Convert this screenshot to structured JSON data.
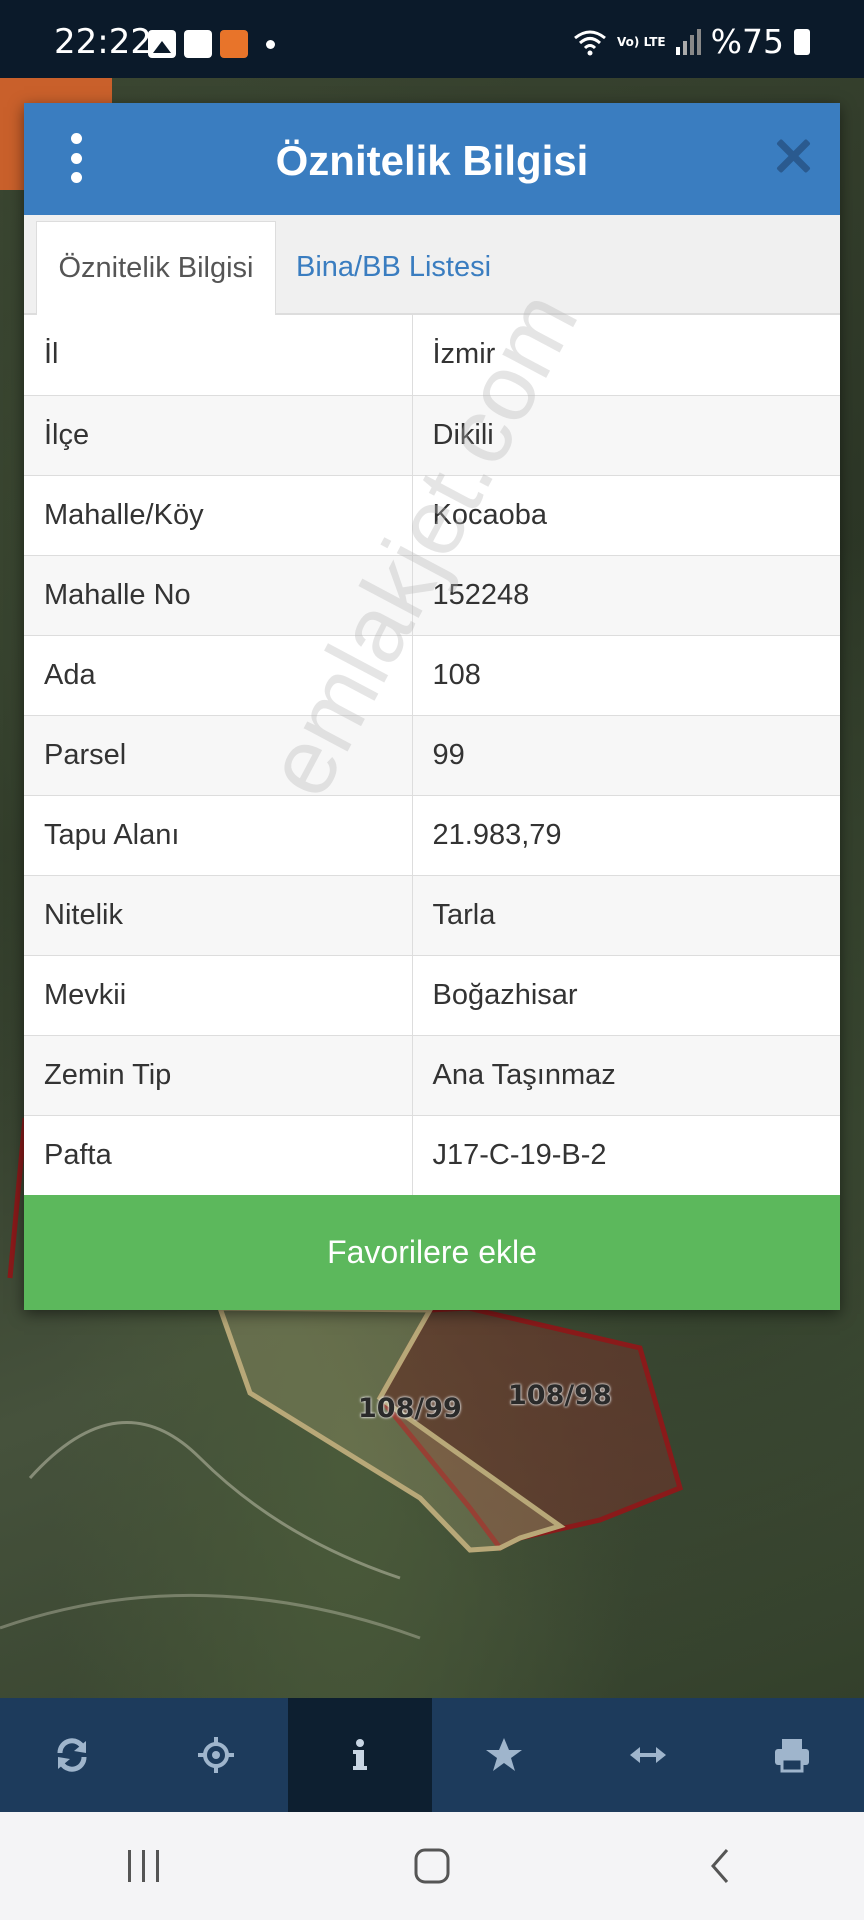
{
  "status_bar": {
    "time": "22:22",
    "network": "Vo) LTE",
    "battery": "%75"
  },
  "map": {
    "parcel_labels": [
      "108/99",
      "108/98"
    ]
  },
  "dialog": {
    "title": "Öznitelik Bilgisi",
    "tabs": [
      {
        "label": "Öznitelik Bilgisi",
        "active": true
      },
      {
        "label": "Bina/BB Listesi",
        "active": false
      }
    ],
    "rows": [
      {
        "key": "İl",
        "value": "İzmir"
      },
      {
        "key": "İlçe",
        "value": "Dikili"
      },
      {
        "key": "Mahalle/Köy",
        "value": "Kocaoba"
      },
      {
        "key": "Mahalle No",
        "value": "152248"
      },
      {
        "key": "Ada",
        "value": "108"
      },
      {
        "key": "Parsel",
        "value": "99"
      },
      {
        "key": "Tapu Alanı",
        "value": "21.983,79"
      },
      {
        "key": "Nitelik",
        "value": "Tarla"
      },
      {
        "key": "Mevkii",
        "value": "Boğazhisar"
      },
      {
        "key": "Zemin Tip",
        "value": "Ana Taşınmaz"
      },
      {
        "key": "Pafta",
        "value": "J17-C-19-B-2"
      }
    ],
    "favorite_button": "Favorilere ekle",
    "watermark": "emlakjet.com"
  },
  "toolbar": {
    "items": [
      "refresh-icon",
      "locate-icon",
      "info-icon",
      "star-icon",
      "measure-icon",
      "print-icon"
    ],
    "active": "info-icon"
  },
  "colors": {
    "header": "#3a7dc0",
    "button": "#5cb85c",
    "toolbar": "#1d3b5c"
  }
}
